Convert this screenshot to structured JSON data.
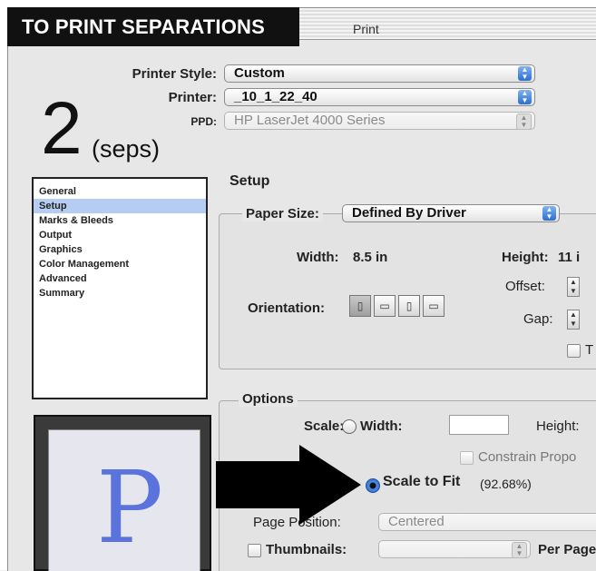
{
  "banner": {
    "text": "TO PRINT SEPARATIONS"
  },
  "window": {
    "title": "Print"
  },
  "printer_setup": {
    "printer_style_label": "Printer Style:",
    "printer_style_value": "Custom",
    "printer_label": "Printer:",
    "printer_value": "_10_1_22_40",
    "ppd_label": "PPD:",
    "ppd_value": "HP LaserJet 4000 Series"
  },
  "overlay": {
    "big_number": "2",
    "seps_text": "(seps)"
  },
  "sidebar": {
    "items": [
      {
        "label": "General",
        "selected": false
      },
      {
        "label": "Setup",
        "selected": true
      },
      {
        "label": "Marks & Bleeds",
        "selected": false
      },
      {
        "label": "Output",
        "selected": false
      },
      {
        "label": "Graphics",
        "selected": false
      },
      {
        "label": "Color Management",
        "selected": false
      },
      {
        "label": "Advanced",
        "selected": false
      },
      {
        "label": "Summary",
        "selected": false
      }
    ]
  },
  "preview": {
    "letter": "P"
  },
  "setup": {
    "section_title": "Setup",
    "paper_size_label": "Paper Size:",
    "paper_size_value": "Defined By Driver",
    "width_label": "Width:",
    "width_value": "8.5 in",
    "height_label": "Height:",
    "height_value": "11 i",
    "offset_label": "Offset:",
    "gap_label": "Gap:",
    "orientation_label": "Orientation:",
    "transverse_label": "T"
  },
  "options": {
    "group_label": "Options",
    "scale_label": "Scale:",
    "width_radio_label": "Width:",
    "height_label": "Height:",
    "constrain_label": "Constrain Propo",
    "scale_to_fit_label": "Scale to Fit",
    "scale_to_fit_value": "(92.68%)",
    "page_position_label": "Page Position:",
    "page_position_value": "Centered",
    "thumbnails_label": "Thumbnails:",
    "per_page_label": "Per Page"
  },
  "colors": {
    "banner_bg": "#111111",
    "selection": "#b5cdf2",
    "preview_letter": "#5b73dc"
  }
}
